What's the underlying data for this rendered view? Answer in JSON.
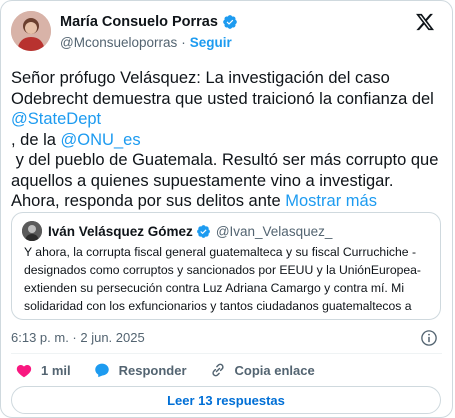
{
  "author": {
    "display_name": "María Consuelo Porras",
    "handle": "@Mconsueloporras",
    "separator": "·",
    "follow_label": "Seguir"
  },
  "tweet": {
    "lines": [
      [
        {
          "t": "Señor prófugo Velásquez: La investigación del caso",
          "link": false
        }
      ],
      [
        {
          "t": "Odebrecht demuestra que usted traicionó la confianza del",
          "link": false
        }
      ],
      [
        {
          "t": "@StateDept",
          "link": true
        }
      ],
      [
        {
          "t": ", de la ",
          "link": false
        },
        {
          "t": "@ONU_es",
          "link": true
        }
      ],
      [
        {
          "t": " y del pueblo de Guatemala. Resultó ser más corrupto que",
          "link": false
        }
      ],
      [
        {
          "t": "aquellos a quienes supuestamente vino a investigar.",
          "link": false
        }
      ],
      [
        {
          "t": "Ahora, responda por sus delitos ante ",
          "link": false
        },
        {
          "t": "Mostrar más",
          "link": true
        }
      ]
    ]
  },
  "quote": {
    "display_name": "Iván Velásquez Gómez",
    "handle": "@Ivan_Velasquez_",
    "lines": [
      "Y ahora, la corrupta fiscal general guatemalteca y su fiscal Curruchiche -",
      "designados como corruptos y sancionados por EEUU y la UniónEuropea-",
      "extienden su persecución contra Luz Adriana Camargo y contra mí. Mi",
      "solidaridad con los exfuncionarios y tantos ciudadanos guatemaltecos a"
    ]
  },
  "timestamp": "6:13 p. m. · 2 jun. 2025",
  "actions": {
    "likes": "1 mil",
    "reply_label": "Responder",
    "copy_label": "Copia enlace"
  },
  "replies_button": "Leer 13 respuestas",
  "colors": {
    "link": "#1d9bf0",
    "like": "#f91880",
    "muted": "#536471"
  }
}
